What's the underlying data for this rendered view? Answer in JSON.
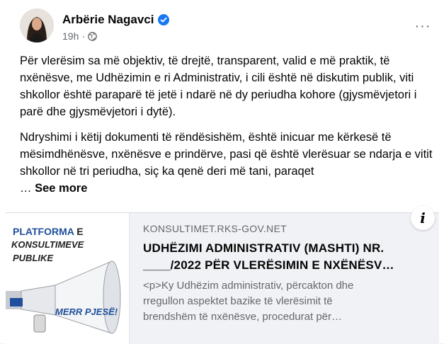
{
  "post": {
    "author": "Arbërie Nagavci",
    "time": "19h",
    "separator": "·",
    "more_label": "···",
    "paragraph1": "Për vlerësim sa më objektiv, të drejtë, transparent, valid e më praktik, të nxënësve, me Udhëzimin e ri Administrativ, i cili është në diskutim publik, viti shkollor është paraparë të jetë i ndarë në dy periudha kohore (gjysmëvjetori i parë dhe gjysmëvjetori i dytë).",
    "paragraph2": "Ndryshimi i këtij dokumenti të rëndësishëm, është inicuar me kërkesë të mësimdhënësve, nxënësve e prindërve, pasi që është vlerësuar se ndarja e vitit shkollor në tri periudha, siç ka qenë deri më tani, paraqet",
    "ellipsis": "…",
    "see_more": "See more"
  },
  "link_preview": {
    "thumb_line1a": "PLATFORMA",
    "thumb_line1b": "E",
    "thumb_line2": "KONSULTIMEVE",
    "thumb_line3": "PUBLIKE",
    "thumb_line4": "MERR PJESË!",
    "info_label": "i",
    "domain": "KONSULTIMET.RKS-GOV.NET",
    "title_line1": "UDHËZIMI ADMINISTRATIV (MASHTI) NR.",
    "title_line2": "____/2022 PËR VLERËSIMIN E NXËNËSV…",
    "desc_line1": "<p>Ky Udhëzim administrativ, përcakton dhe",
    "desc_line2": "rregullon aspektet bazike të vlerësimit të",
    "desc_line3": "brendshëm të nxënësve, procedurat për…"
  },
  "icons": {
    "verified": "verified-badge-icon",
    "audience": "globe-icon",
    "more": "more-options-icon",
    "info": "info-icon"
  },
  "colors": {
    "verified_blue": "#1877f2",
    "secondary_text": "#65676b",
    "link_bg": "#f0f2f5"
  }
}
